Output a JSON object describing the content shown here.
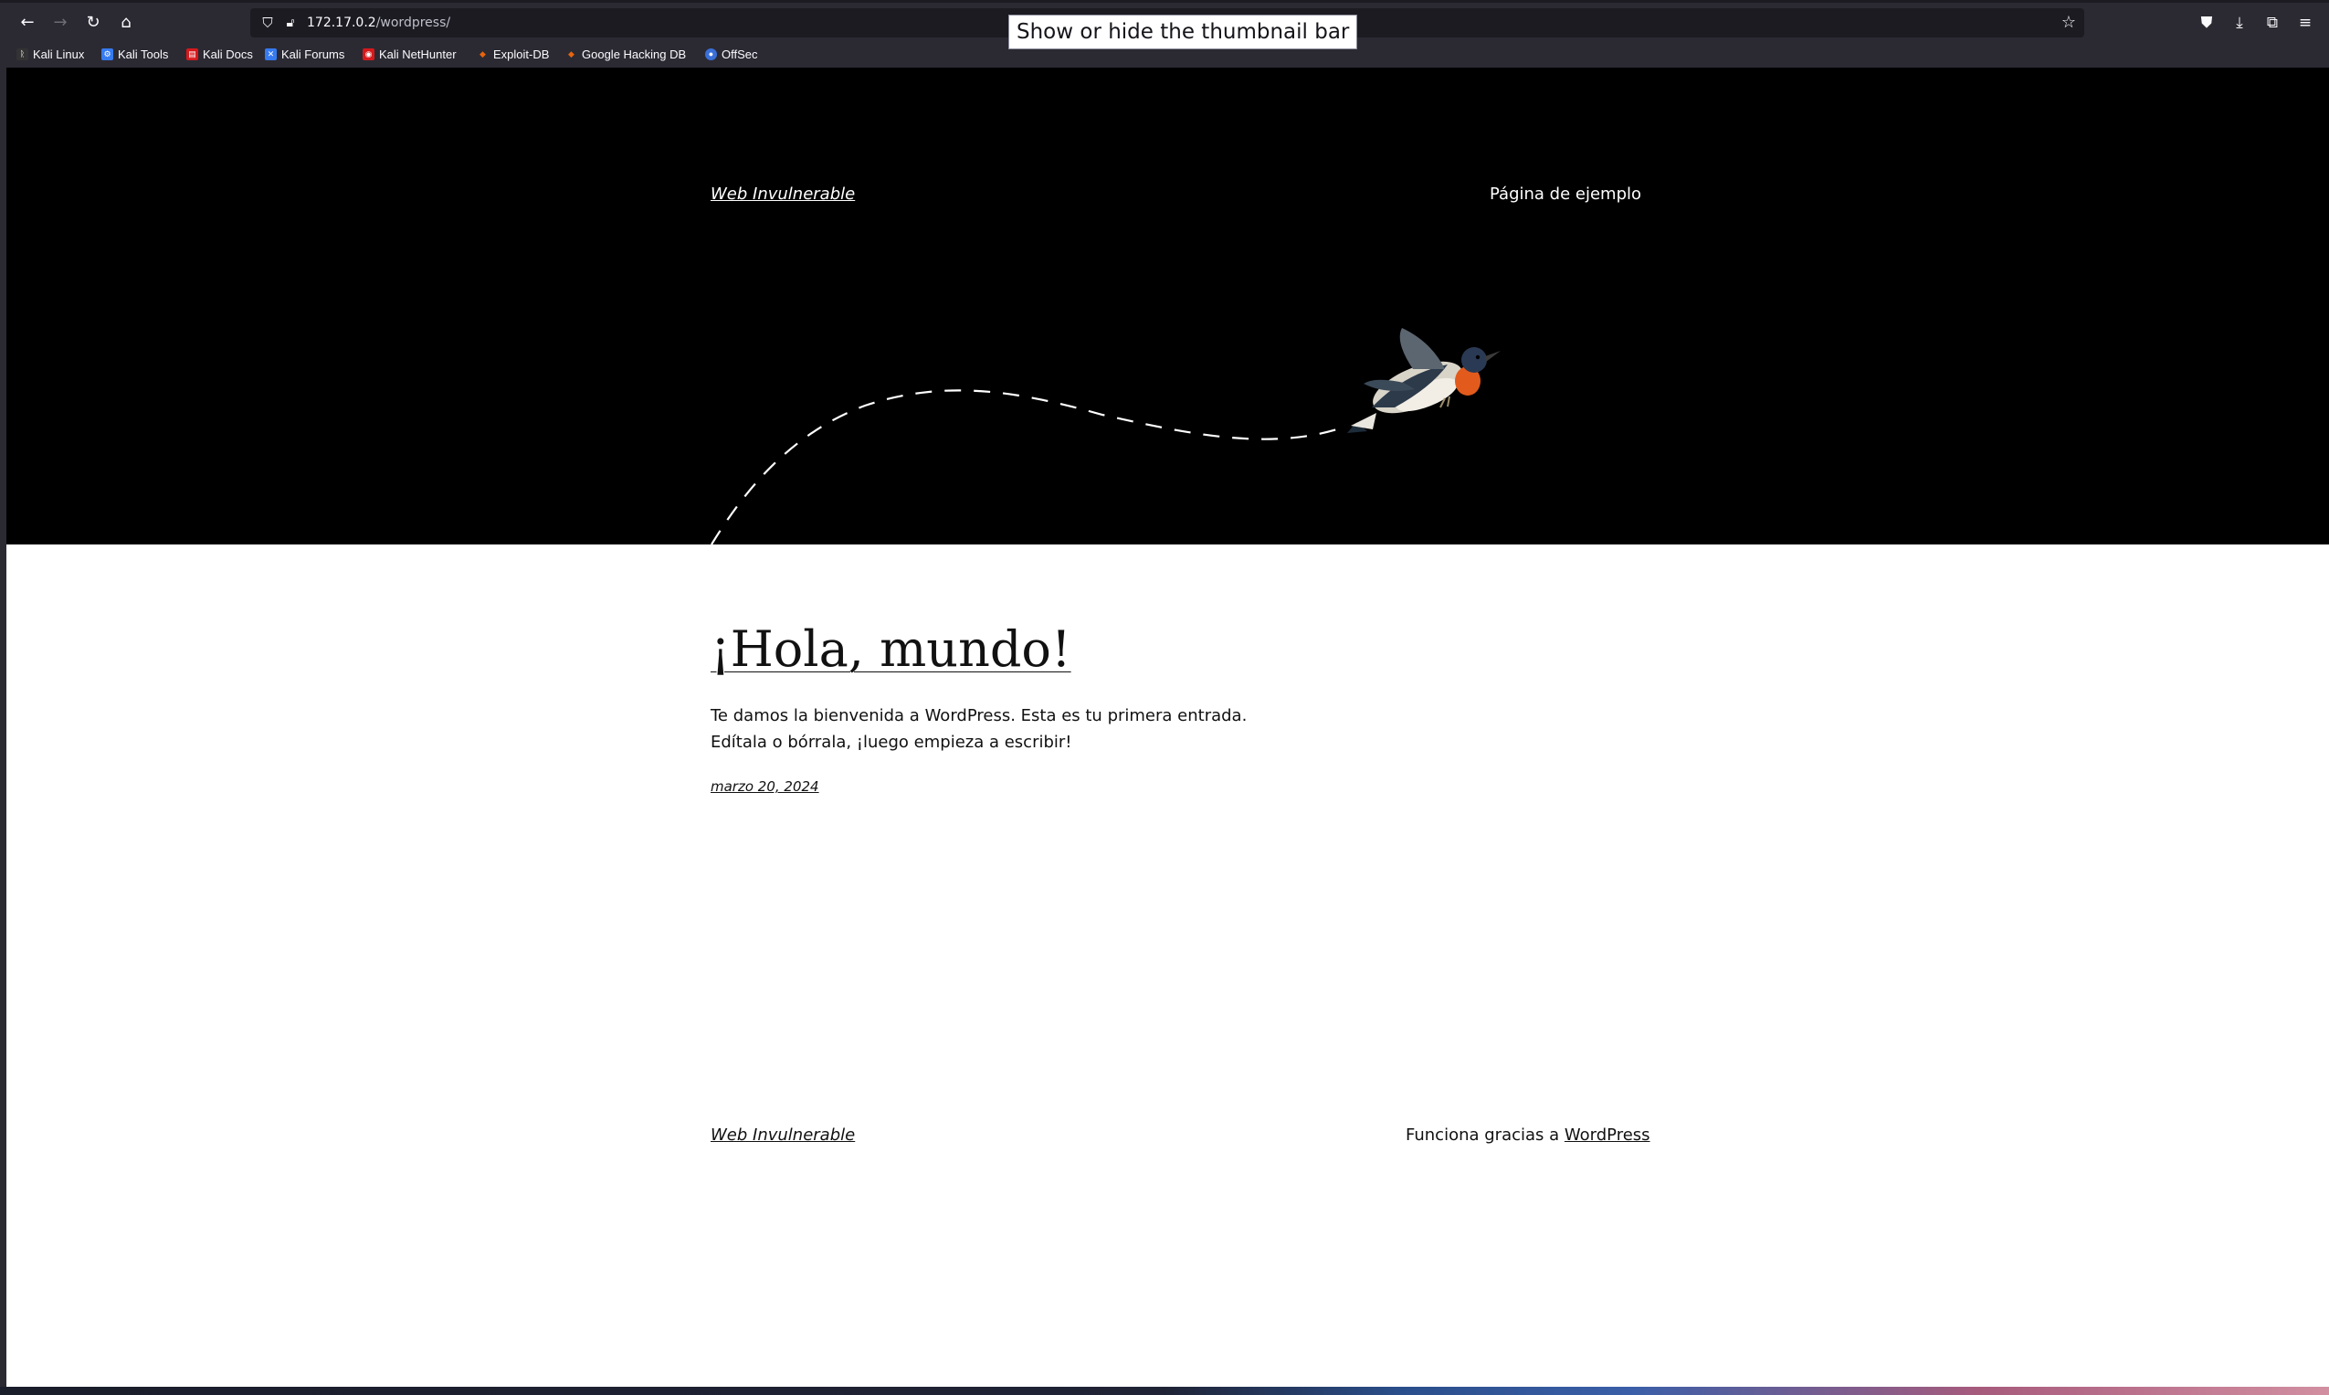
{
  "browser": {
    "url_host": "172.17.0.2",
    "url_path": "/wordpress/",
    "tooltip": "Show or hide the thumbnail bar",
    "nav_icons": {
      "back": "back-arrow-icon",
      "forward": "forward-arrow-icon",
      "reload": "reload-icon",
      "home": "home-icon"
    },
    "right_icons": [
      "pocket-icon",
      "download-icon",
      "extensions-icon",
      "menu-icon"
    ],
    "bookmarks": [
      {
        "label": "Kali Linux",
        "icon": "kali-dragon-icon",
        "color": "#367bf0"
      },
      {
        "label": "Kali Tools",
        "icon": "kali-tools-icon",
        "color": "#367bf0"
      },
      {
        "label": "Kali Docs",
        "icon": "kali-docs-icon",
        "color": "#d7191c"
      },
      {
        "label": "Kali Forums",
        "icon": "kali-forums-icon",
        "color": "#367bf0"
      },
      {
        "label": "Kali NetHunter",
        "icon": "nethunter-icon",
        "color": "#d7191c"
      },
      {
        "label": "Exploit-DB",
        "icon": "exploit-db-icon",
        "color": "#e8640c"
      },
      {
        "label": "Google Hacking DB",
        "icon": "ghdb-icon",
        "color": "#e8640c"
      },
      {
        "label": "OffSec",
        "icon": "offsec-icon",
        "color": "#3a6fd8"
      }
    ]
  },
  "site": {
    "title": "Web Invulnerable",
    "nav_link": "Página de ejemplo"
  },
  "post": {
    "title": "¡Hola, mundo!",
    "body": "Te damos la bienvenida a WordPress. Esta es tu primera entrada. Edítala o bórrala, ¡luego empieza a escribir!",
    "date": "marzo 20, 2024"
  },
  "footer": {
    "title": "Web Invulnerable",
    "credit_prefix": "Funciona gracias a ",
    "credit_link": "WordPress"
  },
  "colors": {
    "chrome_bg": "#2b2a33",
    "urlbar_bg": "#1c1b22",
    "hero_bg": "#000000",
    "page_bg": "#ffffff",
    "text": "#111111"
  }
}
